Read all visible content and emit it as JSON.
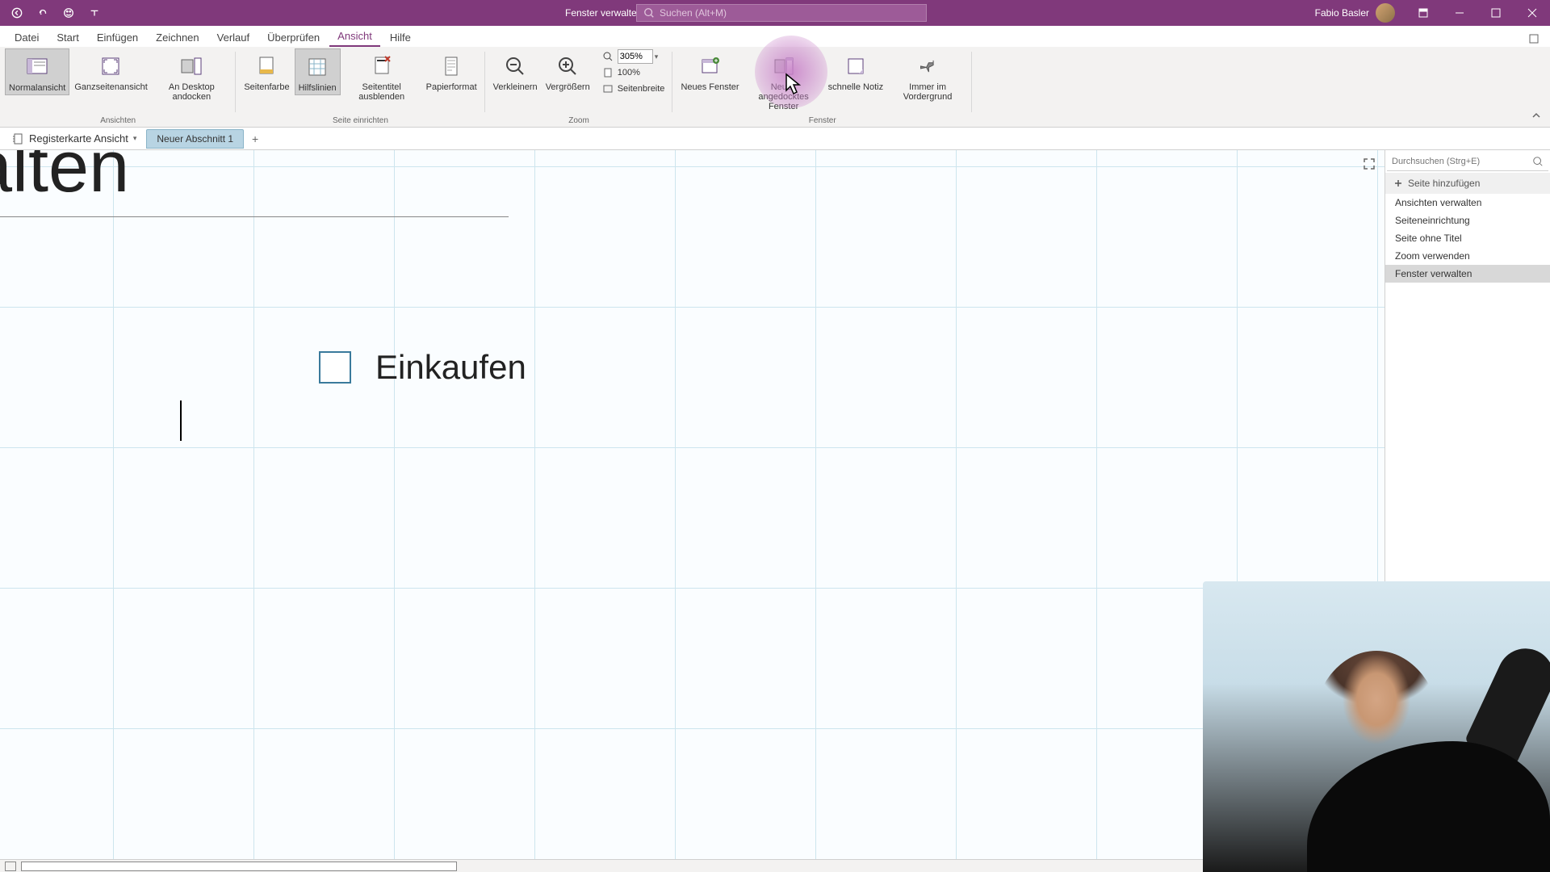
{
  "titlebar": {
    "title": "Fenster verwalten  -  OneNote",
    "search_placeholder": "Suchen (Alt+M)",
    "user_name": "Fabio Basler"
  },
  "menu": {
    "tabs": [
      "Datei",
      "Start",
      "Einfügen",
      "Zeichnen",
      "Verlauf",
      "Überprüfen",
      "Ansicht",
      "Hilfe"
    ],
    "active_index": 6
  },
  "ribbon": {
    "groups": {
      "ansichten": {
        "label": "Ansichten",
        "normalansicht": "Normalansicht",
        "ganzseitenansicht": "Ganzseitenansicht",
        "an_desktop": "An Desktop andocken"
      },
      "seite": {
        "label": "Seite einrichten",
        "seitenfarbe": "Seitenfarbe",
        "hilfslinien": "Hilfslinien",
        "seitentitel": "Seitentitel ausblenden",
        "papierformat": "Papierformat"
      },
      "zoom": {
        "label": "Zoom",
        "verkleinern": "Verkleinern",
        "vergroessern": "Vergrößern",
        "percent": "305%",
        "hundred": "100%",
        "seitenbreite": "Seitenbreite"
      },
      "fenster": {
        "label": "Fenster",
        "neues": "Neues Fenster",
        "angedocktes": "Neues angedocktes Fenster",
        "schnelle": "schnelle Notiz",
        "immer": "Immer im Vordergrund"
      }
    }
  },
  "notebook": {
    "name": "Registerkarte Ansicht",
    "section_tab": "Neuer Abschnitt 1"
  },
  "canvas": {
    "page_title": "r verwalten",
    "checkbox_text": "Einkaufen"
  },
  "rightpanel": {
    "search_placeholder": "Durchsuchen (Strg+E)",
    "add_page": "Seite hinzufügen",
    "pages": [
      "Ansichten verwalten",
      "Seiteneinrichtung",
      "Seite ohne Titel",
      "Zoom verwenden",
      "Fenster verwalten"
    ],
    "selected_index": 4
  }
}
